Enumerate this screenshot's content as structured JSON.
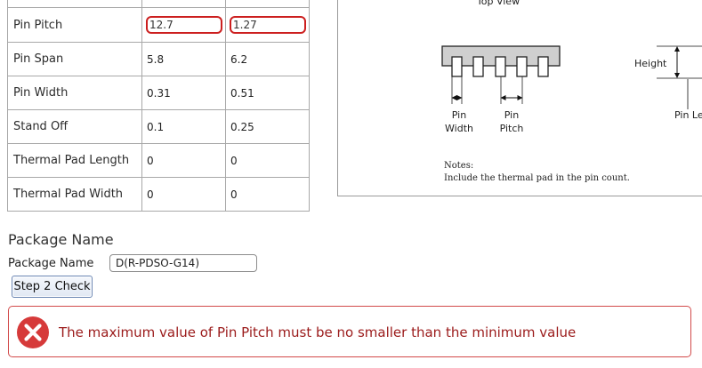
{
  "table": {
    "rows": [
      {
        "label": "Pin Pitch",
        "min": "12.7",
        "max": "1.27",
        "invalid": true
      },
      {
        "label": "Pin Span",
        "min": "5.8",
        "max": "6.2"
      },
      {
        "label": "Pin Width",
        "min": "0.31",
        "max": "0.51"
      },
      {
        "label": "Stand Off",
        "min": "0.1",
        "max": "0.25"
      },
      {
        "label": "Thermal Pad Length",
        "min": "0",
        "max": "0"
      },
      {
        "label": "Thermal Pad Width",
        "min": "0",
        "max": "0"
      }
    ]
  },
  "diagram": {
    "title": "Top View",
    "pin_width_label": [
      "Pin",
      "Width"
    ],
    "pin_pitch_label": [
      "Pin",
      "Pitch"
    ],
    "height_label": "Height",
    "pin_length_label": "Pin Le",
    "notes_title": "Notes:",
    "notes_text": "Include the thermal pad in the pin count."
  },
  "package": {
    "section_title": "Package Name",
    "field_label": "Package Name",
    "field_value": "D(R-PDSO-G14)",
    "check_button": "Step 2 Check"
  },
  "error": {
    "icon": "error-x-icon",
    "message": "The maximum value of Pin Pitch must be no smaller than the minimum value",
    "color": "#cc2c2c"
  }
}
